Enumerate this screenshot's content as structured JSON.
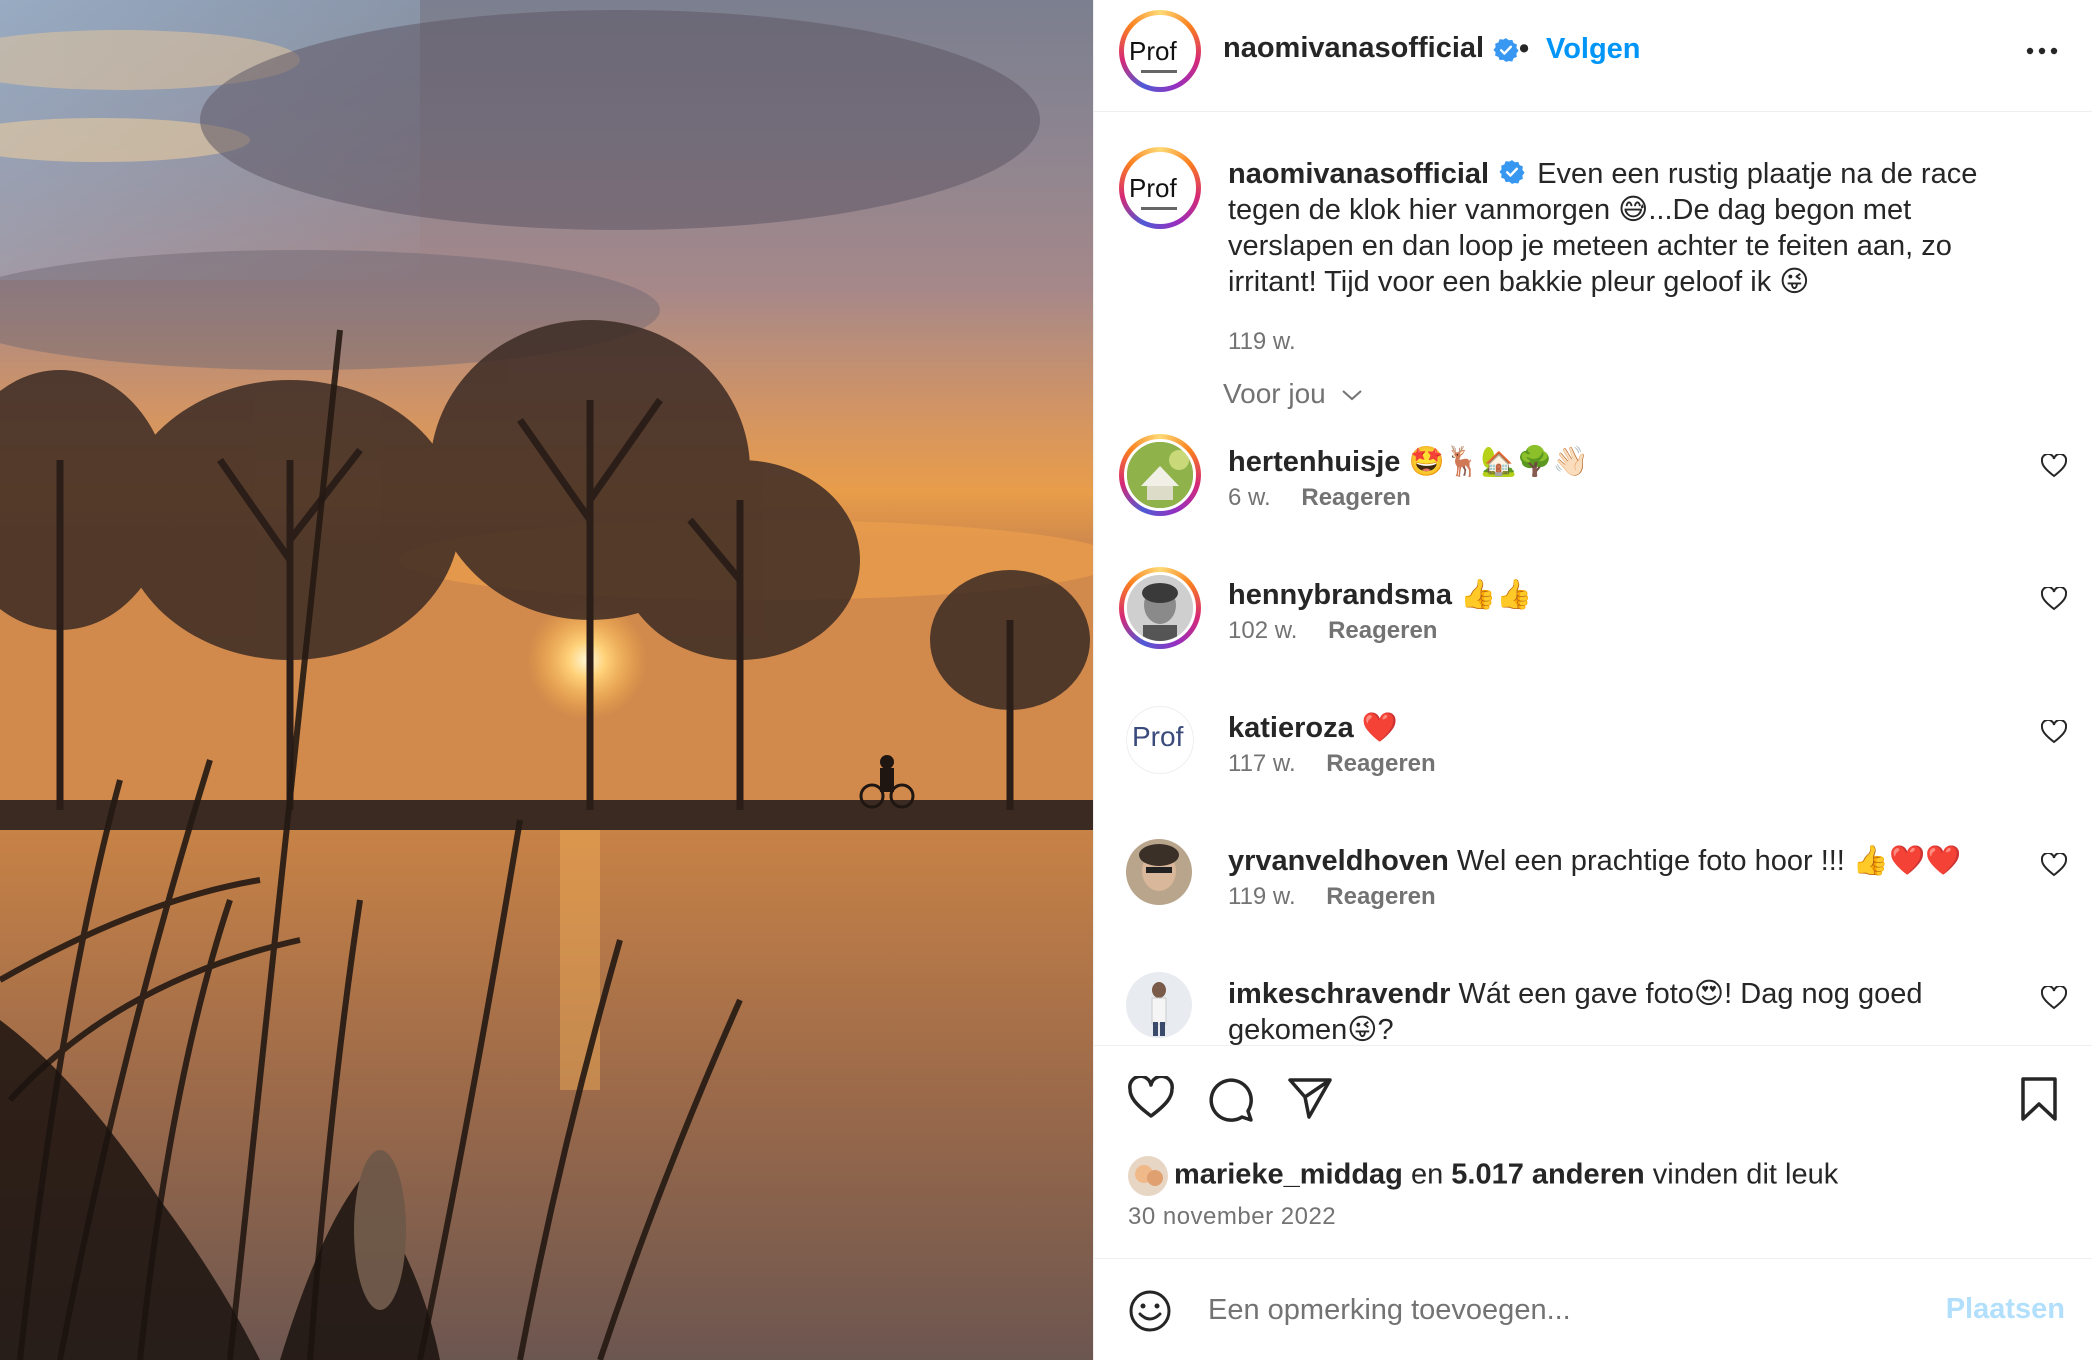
{
  "post": {
    "username": "naomivanasofficial",
    "follow_label": "Volgen",
    "dot": "•",
    "avatar_text": "Prof",
    "caption_user": "naomivanasofficial",
    "caption_line1": "Even een rustig plaatje na de race",
    "caption_line2": "tegen de klok hier vanmorgen 😅...De dag begon met",
    "caption_line3": "verslapen en dan loop je meteen achter te feiten aan, zo",
    "caption_line4": "irritant! Tijd voor een bakkie pleur geloof ik 😜",
    "caption_time": "119 w.",
    "sort_label": "Voor jou"
  },
  "comments": [
    {
      "user": "hertenhuisje",
      "text": "🤩🦌🏡🌳👋🏻",
      "time": "6 w.",
      "reply": "Reageren"
    },
    {
      "user": "hennybrandsma",
      "text": "👍👍",
      "time": "102 w.",
      "reply": "Reageren"
    },
    {
      "user": "katieroza",
      "text": "❤️",
      "time": "117 w.",
      "reply": "Reageren",
      "avatar_text": "Prof"
    },
    {
      "user": "yrvanveldhoven",
      "text": "Wel een prachtige foto hoor !!! 👍❤️❤️",
      "time": "119 w.",
      "reply": "Reageren"
    },
    {
      "user": "imkeschravendr",
      "text": "Wát een gave foto😍! Dag nog goed",
      "text2": "gekomen😜?"
    }
  ],
  "likes": {
    "user": "marieke_middag",
    "connector": "en",
    "count": "5.017 anderen",
    "suffix": "vinden dit leuk"
  },
  "date": "30 november 2022",
  "composer": {
    "placeholder": "Een opmerking toevoegen...",
    "post_label": "Plaatsen"
  },
  "colors": {
    "accent": "#0095f6",
    "verified": "#3897f0",
    "post_disabled": "#b2dffc",
    "muted": "#737373"
  }
}
